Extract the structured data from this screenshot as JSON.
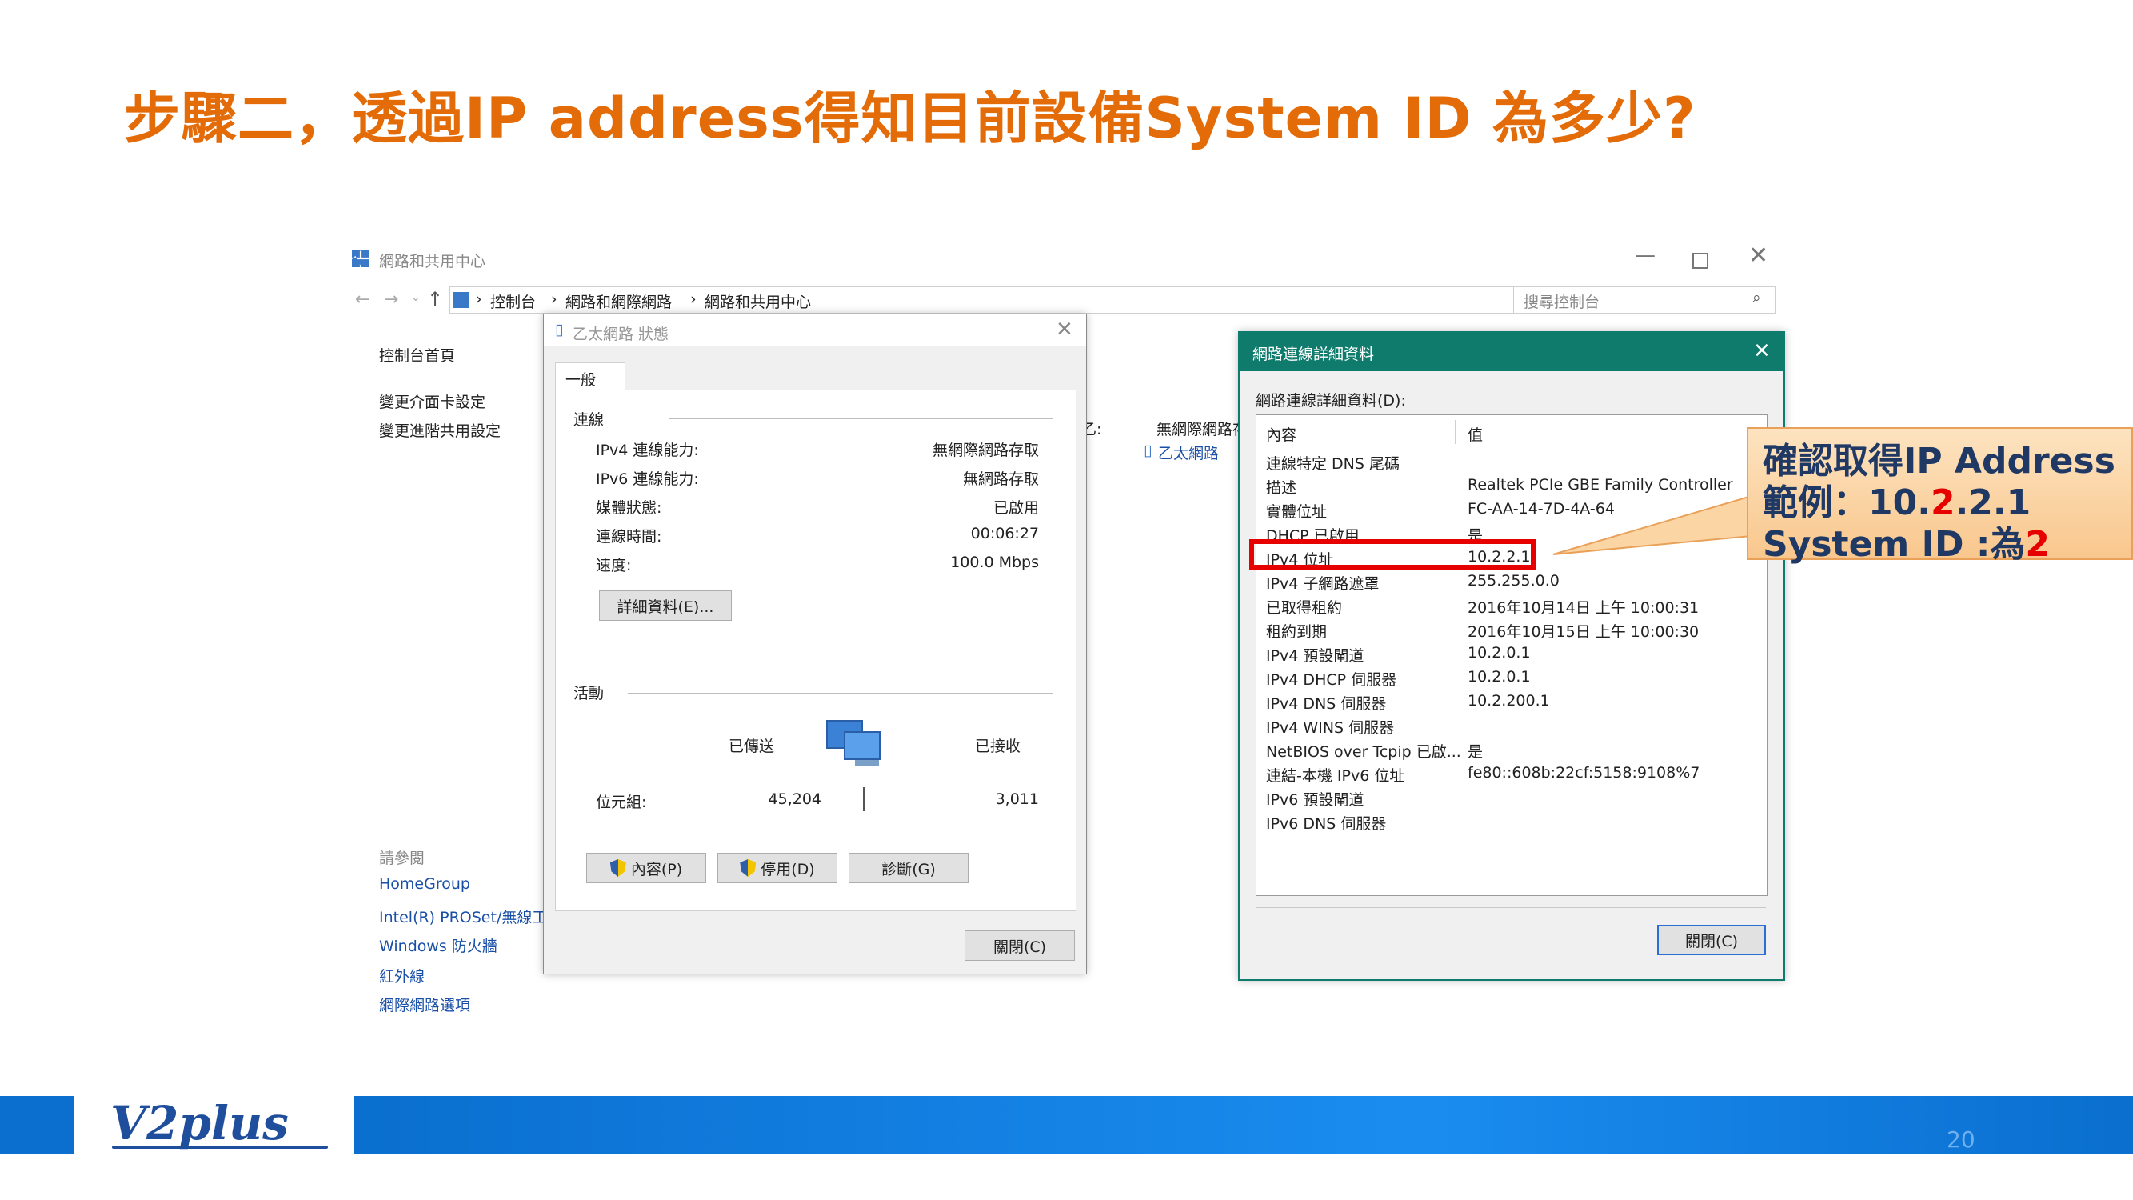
{
  "slide": {
    "title": "步驟二，透過IP address得知目前設備System ID 為多少?",
    "page_number": "20",
    "logo_text": "V2plus"
  },
  "control_panel": {
    "window_title": "網路和共用中心",
    "breadcrumb": [
      "控制台",
      "網路和網際網路",
      "網路和共用中心"
    ],
    "search_placeholder": "搜尋控制台",
    "left_nav": [
      "控制台首頁",
      "變更介面卡設定",
      "變更進階共用設定"
    ],
    "see_also_label": "請參閱",
    "see_also": [
      "HomeGroup",
      "Intel(R) PROSet/無線工",
      "Windows 防火牆",
      "紅外線",
      "網際網路選項"
    ],
    "access_type_label": "無網際網路存",
    "connection_label": "乙:",
    "adapter_link": "乙太網路"
  },
  "status_dialog": {
    "title": "乙太網路 狀態",
    "tab": "一般",
    "connection_section": "連線",
    "rows": [
      {
        "label": "IPv4 連線能力:",
        "value": "無網際網路存取"
      },
      {
        "label": "IPv6 連線能力:",
        "value": "無網路存取"
      },
      {
        "label": "媒體狀態:",
        "value": "已啟用"
      },
      {
        "label": "連線時間:",
        "value": "00:06:27"
      },
      {
        "label": "速度:",
        "value": "100.0 Mbps"
      }
    ],
    "details_button": "詳細資料(E)...",
    "activity_section": "活動",
    "sent_label": "已傳送",
    "received_label": "已接收",
    "bytes_label": "位元組:",
    "bytes_sent": "45,204",
    "bytes_received": "3,011",
    "properties_button": "內容(P)",
    "disable_button": "停用(D)",
    "diagnose_button": "診斷(G)",
    "close_button": "關閉(C)"
  },
  "details_dialog": {
    "title": "網路連線詳細資料",
    "label": "網路連線詳細資料(D):",
    "col_property": "內容",
    "col_value": "值",
    "rows": [
      {
        "property": "連線特定 DNS 尾碼",
        "value": ""
      },
      {
        "property": "描述",
        "value": "Realtek PCIe GBE Family Controller"
      },
      {
        "property": "實體位址",
        "value": "FC-AA-14-7D-4A-64"
      },
      {
        "property": "DHCP 已啟用",
        "value": "是"
      },
      {
        "property": "IPv4 位址",
        "value": "10.2.2.1"
      },
      {
        "property": "IPv4 子網路遮罩",
        "value": "255.255.0.0"
      },
      {
        "property": "已取得租約",
        "value": "2016年10月14日 上午 10:00:31"
      },
      {
        "property": "租約到期",
        "value": "2016年10月15日 上午 10:00:30"
      },
      {
        "property": "IPv4 預設閘道",
        "value": "10.2.0.1"
      },
      {
        "property": "IPv4 DHCP 伺服器",
        "value": "10.2.0.1"
      },
      {
        "property": "IPv4 DNS 伺服器",
        "value": "10.2.200.1"
      },
      {
        "property": "IPv4 WINS 伺服器",
        "value": ""
      },
      {
        "property": "NetBIOS over Tcpip 已啟...",
        "value": "是"
      },
      {
        "property": "連結-本機 IPv6 位址",
        "value": "fe80::608b:22cf:5158:9108%7"
      },
      {
        "property": "IPv6 預設閘道",
        "value": ""
      },
      {
        "property": "IPv6 DNS 伺服器",
        "value": ""
      }
    ],
    "close_button": "關閉(C)"
  },
  "callout": {
    "line1": "確認取得IP Address",
    "line2_prefix": "範例：10.",
    "line2_highlight": "2",
    "line2_suffix": ".2.1",
    "line3_prefix": "System ID :為",
    "line3_highlight": "2"
  },
  "colors": {
    "title": "#e36c09",
    "details_titlebar": "#0f7b6c",
    "highlight_box": "#e60000",
    "callout_bg": "#fbd5a4",
    "footer": "#0a6fcf"
  }
}
